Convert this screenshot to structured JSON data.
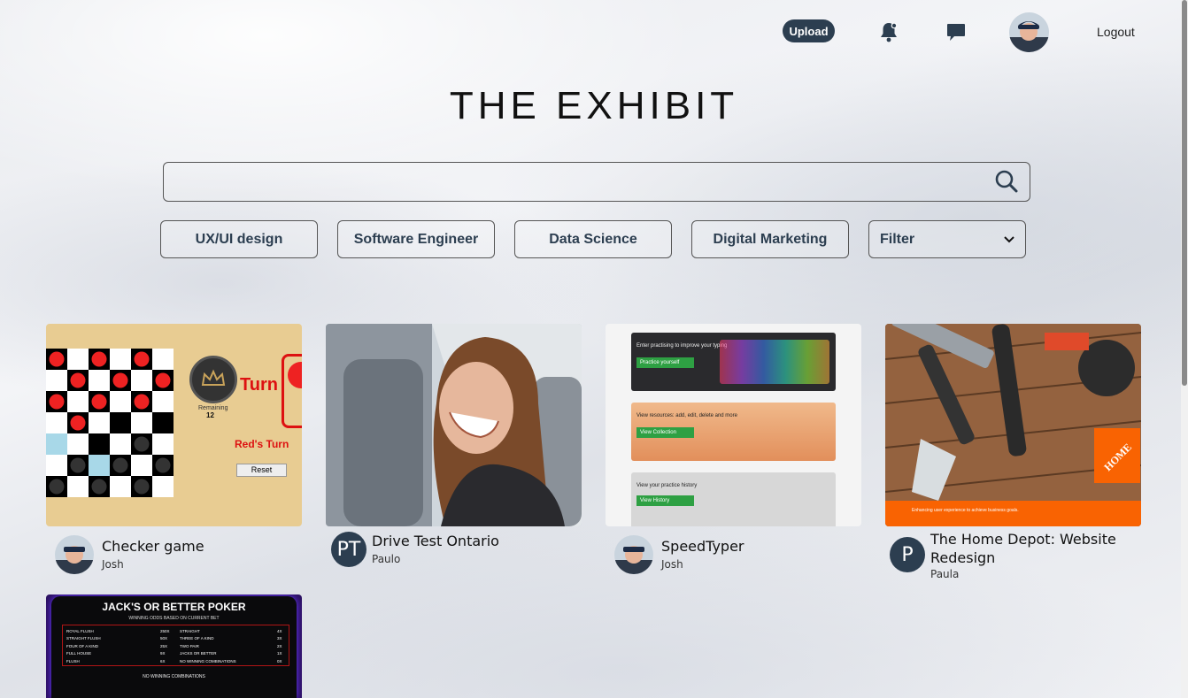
{
  "header": {
    "upload_label": "Upload",
    "logout_label": "Logout",
    "icons": [
      "bell-icon",
      "chat-icon"
    ]
  },
  "site": {
    "title": "THE EXHIBIT"
  },
  "search": {
    "placeholder": "",
    "value": ""
  },
  "categories": [
    {
      "label": "UX/UI design"
    },
    {
      "label": "Software Engineer"
    },
    {
      "label": "Data Science"
    },
    {
      "label": "Digital Marketing"
    }
  ],
  "filter": {
    "selected": "Filter"
  },
  "projects": [
    {
      "title": "Checker game",
      "author": "Josh",
      "thumb": {
        "turn_text": "Turn",
        "reds_turn": "Red's Turn",
        "remaining_label": "Remaining",
        "remaining_value": "12",
        "reset_label": "Reset"
      }
    },
    {
      "title": "Drive Test Ontario",
      "author": "Paulo",
      "initials": "PT"
    },
    {
      "title": "SpeedTyper",
      "author": "Josh",
      "thumb": {
        "panel1": "Enter practising to improve your typing",
        "btn1": "Practice yourself",
        "panel2": "View resources: add, edit, delete and more",
        "btn2": "View Collection",
        "panel3": "View your practice history",
        "btn3": "View History"
      }
    },
    {
      "title": "The Home Depot: Website Redesign",
      "author": "Paula",
      "initials": "P",
      "thumb": {
        "tagline": "Enhancing user experience to achieve business goals."
      }
    },
    {
      "title": "",
      "author": "",
      "thumb": {
        "heading": "JACK'S OR BETTER POKER",
        "sub": "WINNING ODDS BASED ON CURRENT BET",
        "rows": [
          [
            "ROYAL FLUSH",
            "250X",
            "STRAIGHT",
            "4X"
          ],
          [
            "STRAIGHT FLUSH",
            "50X",
            "THREE OF A KIND",
            "3X"
          ],
          [
            "FOUR OF A KIND",
            "25X",
            "TWO PAIR",
            "2X"
          ],
          [
            "FULL HOUSE",
            "9X",
            "JACKS OR BETTER",
            "1X"
          ],
          [
            "FLUSH",
            "6X",
            "NO WINNING COMBINATIONS",
            "0X"
          ]
        ],
        "footer": "NO WINNING COMBINATIONS"
      }
    }
  ],
  "colors": {
    "accent": "#2c3e50",
    "red_piece": "#ee2222",
    "hd_orange": "#f96302"
  }
}
